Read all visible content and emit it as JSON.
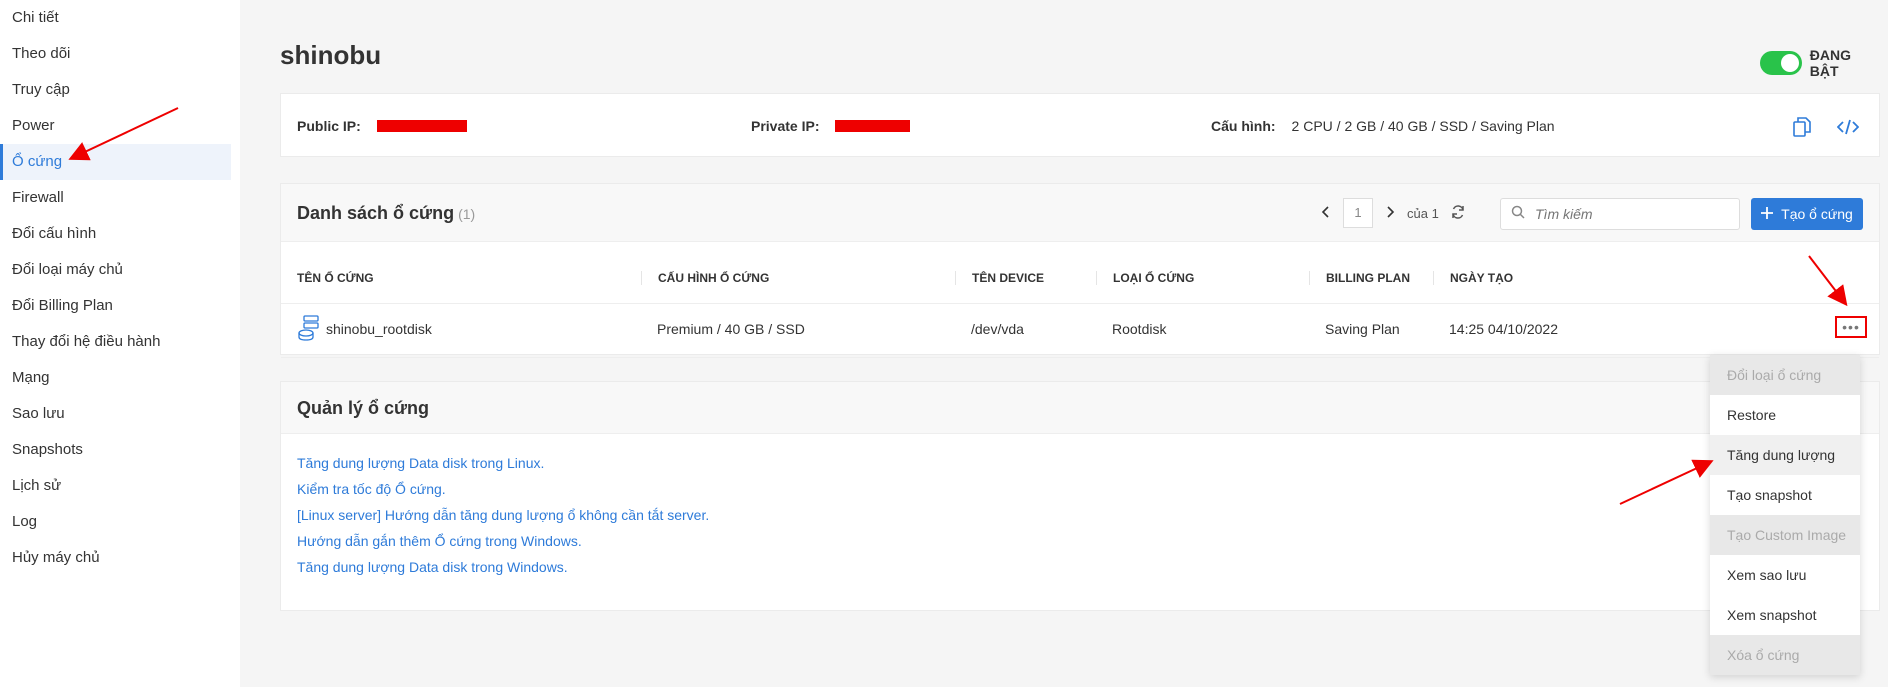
{
  "sidebar": {
    "items": [
      {
        "label": "Chi tiết"
      },
      {
        "label": "Theo dõi"
      },
      {
        "label": "Truy cập"
      },
      {
        "label": "Power"
      },
      {
        "label": "Ổ cứng"
      },
      {
        "label": "Firewall"
      },
      {
        "label": "Đổi cấu hình"
      },
      {
        "label": "Đổi loại máy chủ"
      },
      {
        "label": "Đổi Billing Plan"
      },
      {
        "label": "Thay đổi hệ điều hành"
      },
      {
        "label": "Mạng"
      },
      {
        "label": "Sao lưu"
      },
      {
        "label": "Snapshots"
      },
      {
        "label": "Lịch sử"
      },
      {
        "label": "Log"
      },
      {
        "label": "Hủy máy chủ"
      }
    ],
    "active_index": 4
  },
  "header": {
    "title": "shinobu",
    "status_label": "ĐANG BẬT"
  },
  "info": {
    "public_ip_label": "Public IP:",
    "private_ip_label": "Private IP:",
    "config_label": "Cấu hình:",
    "config_value": "2 CPU / 2 GB / 40 GB / SSD / Saving Plan"
  },
  "disks": {
    "title": "Danh sách ổ cứng",
    "count": "(1)",
    "page": "1",
    "page_of": "của 1",
    "search_placeholder": "Tìm kiếm",
    "create_label": "Tạo ổ cứng",
    "columns": [
      "TÊN Ổ CỨNG",
      "CẤU HÌNH Ổ CỨNG",
      "TÊN DEVICE",
      "LOẠI Ổ CỨNG",
      "BILLING PLAN",
      "NGÀY TẠO"
    ],
    "rows": [
      {
        "name": "shinobu_rootdisk",
        "config": "Premium / 40 GB / SSD",
        "device": "/dev/vda",
        "type": "Rootdisk",
        "billing": "Saving Plan",
        "created": "14:25 04/10/2022"
      }
    ],
    "more_label": "•••"
  },
  "manage": {
    "title": "Quản lý ổ cứng",
    "links": [
      "Tăng dung lượng Data disk trong Linux.",
      "Kiểm tra tốc độ Ổ cứng.",
      "[Linux server] Hướng dẫn tăng dung lượng ổ không cần tắt server.",
      "Hướng dẫn gắn thêm Ổ cứng trong Windows.",
      "Tăng dung lượng Data disk trong Windows."
    ]
  },
  "menu": {
    "items": [
      {
        "label": "Đổi loại ổ cứng",
        "disabled": true
      },
      {
        "label": "Restore",
        "disabled": false
      },
      {
        "label": "Tăng dung lượng",
        "disabled": false
      },
      {
        "label": "Tạo snapshot",
        "disabled": false
      },
      {
        "label": "Tạo Custom Image",
        "disabled": true
      },
      {
        "label": "Xem sao lưu",
        "disabled": false
      },
      {
        "label": "Xem snapshot",
        "disabled": false
      },
      {
        "label": "Xóa ổ cứng",
        "disabled": true
      }
    ]
  },
  "colors": {
    "accent": "#2e7bd9",
    "toggle_on": "#29c34a",
    "annotation": "#e00000"
  },
  "icons": [
    "copy-icon",
    "code-icon",
    "chevron-left-icon",
    "chevron-right-icon",
    "refresh-icon",
    "search-icon",
    "plus-icon",
    "disk-icon",
    "more-icon"
  ]
}
